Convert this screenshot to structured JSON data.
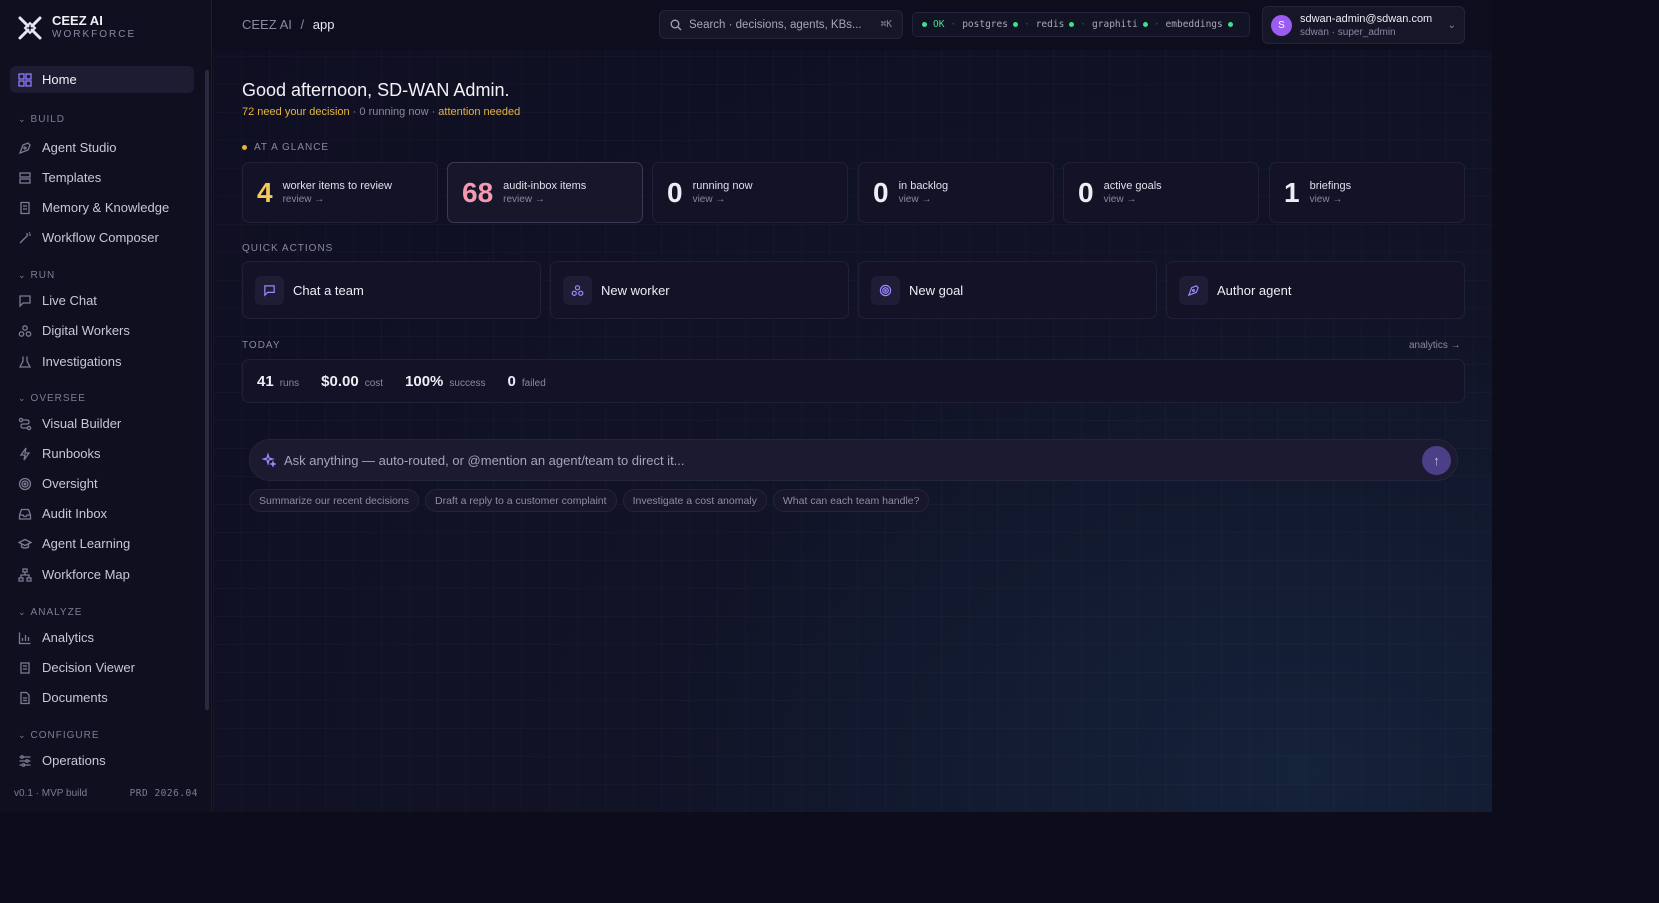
{
  "brand": {
    "title": "CEEZ AI",
    "subtitle": "WORKFORCE"
  },
  "nav": {
    "home": "Home",
    "sections": {
      "build": "BUILD",
      "run": "RUN",
      "oversee": "OVERSEE",
      "analyze": "ANALYZE",
      "configure": "CONFIGURE"
    },
    "items": {
      "agent_studio": "Agent Studio",
      "templates": "Templates",
      "memory": "Memory & Knowledge",
      "workflow": "Workflow Composer",
      "live_chat": "Live Chat",
      "digital_workers": "Digital Workers",
      "investigations": "Investigations",
      "visual_builder": "Visual Builder",
      "runbooks": "Runbooks",
      "oversight": "Oversight",
      "audit_inbox": "Audit Inbox",
      "agent_learning": "Agent Learning",
      "workforce_map": "Workforce Map",
      "analytics": "Analytics",
      "decision_viewer": "Decision Viewer",
      "documents": "Documents",
      "operations": "Operations"
    },
    "footer": {
      "version": "v0.1 · MVP build",
      "env": "PRD 2026.04"
    }
  },
  "topbar": {
    "crumb_root": "CEEZ AI",
    "crumb_sep": "/",
    "crumb_current": "app",
    "search_placeholder": "Search · decisions, agents, KBs...",
    "search_kbd": "⌘K",
    "status": {
      "ok": "OK",
      "services": [
        "postgres",
        "redis",
        "graphiti",
        "embeddings"
      ],
      "ok_color": "#3ee08b"
    },
    "user": {
      "initial": "S",
      "email": "sdwan-admin@sdwan.com",
      "role": "sdwan · super_admin"
    }
  },
  "greeting": {
    "title": "Good afternoon, SD-WAN Admin.",
    "need_decision": "72 need your decision",
    "running": " · 0 running now · ",
    "attention": "attention needed"
  },
  "glance": {
    "heading": "AT A GLANCE",
    "cards": [
      {
        "value": "4",
        "label": "worker items to review",
        "link": "review →"
      },
      {
        "value": "68",
        "label": "audit-inbox items",
        "link": "review →"
      },
      {
        "value": "0",
        "label": "running now",
        "link": "view →"
      },
      {
        "value": "0",
        "label": "in backlog",
        "link": "view →"
      },
      {
        "value": "0",
        "label": "active goals",
        "link": "view →"
      },
      {
        "value": "1",
        "label": "briefings",
        "link": "view →"
      }
    ]
  },
  "quick_actions": {
    "heading": "QUICK ACTIONS",
    "items": [
      "Chat a team",
      "New worker",
      "New goal",
      "Author agent"
    ]
  },
  "today": {
    "heading": "TODAY",
    "analytics_link": "analytics →",
    "stats": [
      {
        "value": "41",
        "label": "runs"
      },
      {
        "value": "$0.00",
        "label": "cost"
      },
      {
        "value": "100%",
        "label": "success"
      },
      {
        "value": "0",
        "label": "failed"
      }
    ]
  },
  "ask": {
    "placeholder": "Ask anything — auto-routed, or @mention an agent/team to direct it...",
    "send": "↑",
    "chips": [
      "Summarize our recent decisions",
      "Draft a reply to a customer complaint",
      "Investigate a cost anomaly",
      "What can each team handle?"
    ]
  }
}
